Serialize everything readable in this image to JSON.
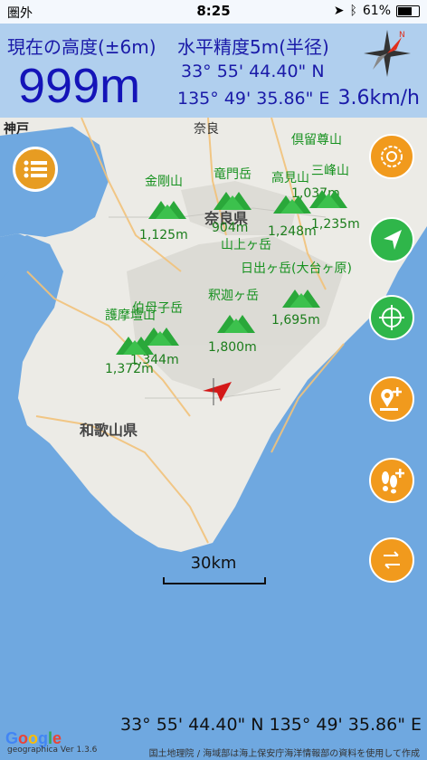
{
  "status_bar": {
    "carrier": "圏外",
    "time": "8:25",
    "battery": "61%",
    "battery_level": 0.61
  },
  "info_panel": {
    "altitude_label": "現在の高度(±6m)",
    "accuracy_label": "水平精度5m(半径)",
    "altitude_value": "999m",
    "latitude": "33° 55' 44.40\" N",
    "longitude": "135° 49' 35.86\" E",
    "speed": "3.6km/h"
  },
  "map_labels": {
    "cities": {
      "kobe": "神戸",
      "nara": "奈良"
    },
    "prefectures": {
      "nara": "奈良県",
      "wakayama": "和歌山県"
    }
  },
  "peaks": [
    {
      "name": "金剛山",
      "elevation": "1,125m"
    },
    {
      "name": "竜門岳",
      "elevation": "904m"
    },
    {
      "name": "高見山",
      "elevation": "1,248m"
    },
    {
      "name": "倶留尊山",
      "elevation": "1,037m"
    },
    {
      "name": "三峰山",
      "elevation": "1,235m"
    },
    {
      "name": "山上ヶ岳",
      "elevation": ""
    },
    {
      "name": "日出ヶ岳(大台ヶ原)",
      "elevation": "1,695m"
    },
    {
      "name": "釈迦ヶ岳",
      "elevation": "1,800m"
    },
    {
      "name": "伯母子岳",
      "elevation": "1,344m"
    },
    {
      "name": "護摩壇山",
      "elevation": "1,372m"
    }
  ],
  "scale": {
    "label": "30km"
  },
  "bottom": {
    "coordinates": "33° 55' 44.40\" N 135° 49' 35.86\" E",
    "google": "Google",
    "version": "geographica Ver 1.3.6",
    "attribution": "国土地理院 / 海域部は海上保安庁海洋情報部の資料を使用して作成"
  },
  "icons": {
    "menu": "menu-icon",
    "compass": "compass-icon",
    "navigate": "navigation-arrow-icon",
    "target": "crosshair-icon",
    "add_pin": "add-pin-icon",
    "add_footprint": "add-footprint-icon",
    "swap": "swap-icon"
  },
  "colors": {
    "accent_orange": "#f19a1d",
    "accent_green": "#2fb64a",
    "text_blue": "#1a1aa8",
    "peak_green": "#16911f",
    "sea": "#6fa8e0",
    "land": "#ecebe6"
  }
}
